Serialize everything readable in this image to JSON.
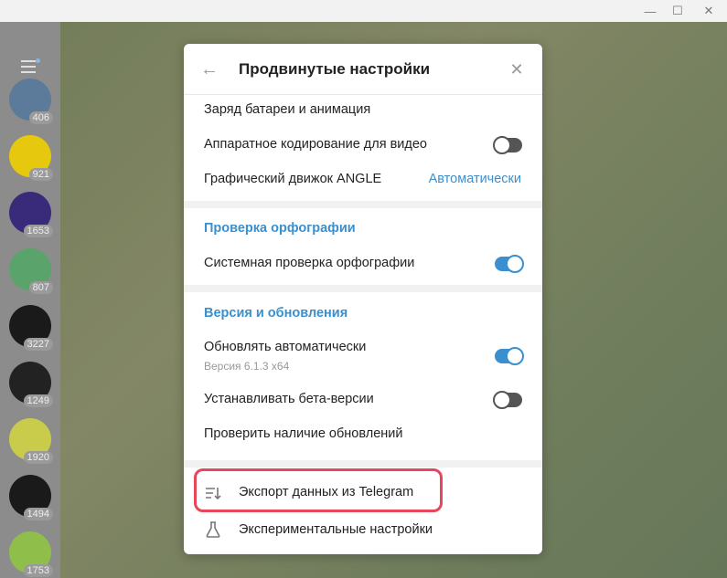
{
  "window": {
    "minimize": "—",
    "maximize": "☐",
    "close": "✕"
  },
  "sidebar": {
    "chats": [
      {
        "badge": "406",
        "color": "#5c7a99"
      },
      {
        "badge": "921",
        "color": "#e6c80e"
      },
      {
        "badge": "1653",
        "color": "#3a2a7a"
      },
      {
        "badge": "807",
        "color": "#5aa36b"
      },
      {
        "badge": "3227",
        "color": "#1a1a1a"
      },
      {
        "badge": "1249",
        "color": "#222222"
      },
      {
        "badge": "1920",
        "color": "#c9cc4a"
      },
      {
        "badge": "1494",
        "color": "#1a1a1a"
      },
      {
        "badge": "1753",
        "color": "#8fbf4a"
      }
    ]
  },
  "dialog": {
    "title": "Продвинутые настройки",
    "rows": {
      "battery": "Заряд батареи и анимация",
      "hw_encoding": "Аппаратное кодирование для видео",
      "angle_label": "Графический движок ANGLE",
      "angle_value": "Автоматически"
    },
    "spelling": {
      "section_title": "Проверка орфографии",
      "system_check": "Системная проверка орфографии"
    },
    "version": {
      "section_title": "Версия и обновления",
      "auto_update": "Обновлять автоматически",
      "version_text": "Версия 6.1.3 x64",
      "beta": "Устанавливать бета-версии",
      "check_updates": "Проверить наличие обновлений"
    },
    "export": "Экспорт данных из Telegram",
    "experimental": "Экспериментальные настройки",
    "toggles": {
      "hw_encoding": false,
      "system_check": true,
      "auto_update": true,
      "beta": false
    }
  },
  "colors": {
    "accent": "#3a8fce",
    "highlight": "#e8465b"
  }
}
